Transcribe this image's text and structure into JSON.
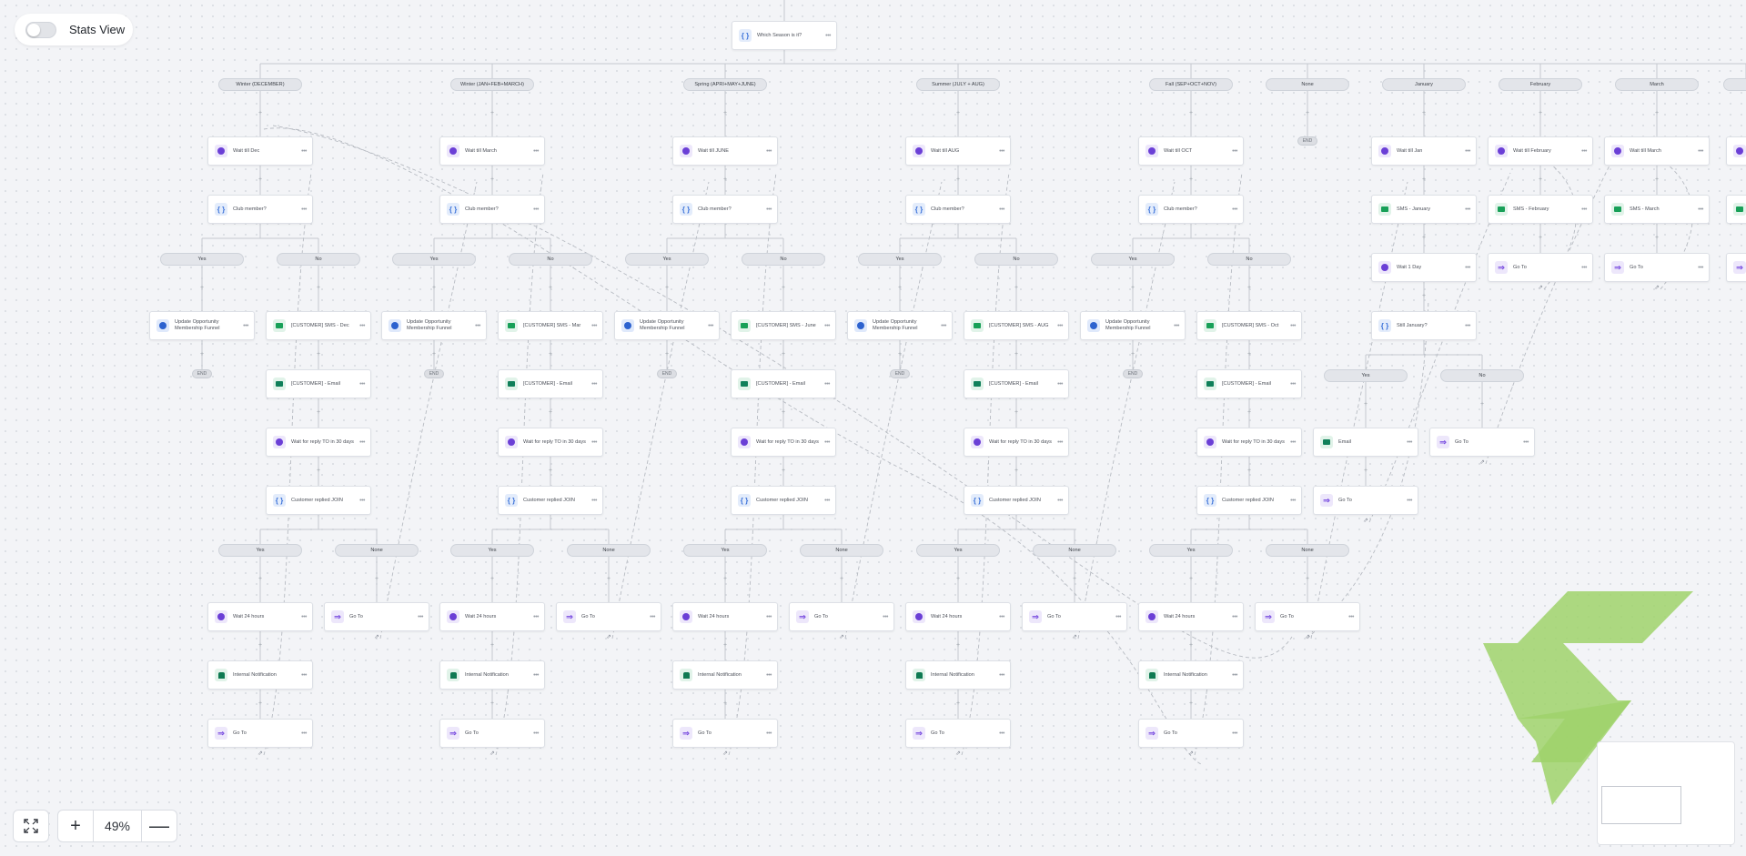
{
  "toolbar": {
    "stats_view_label": "Stats View",
    "stats_view_on": false,
    "zoom_level": "49%",
    "zoom_in_symbol": "+",
    "zoom_out_symbol": "—"
  },
  "root": {
    "label": "Which Season is it?",
    "icon": "condition-icon"
  },
  "branches": [
    {
      "label": "Winter (DECEMBER)",
      "wait": "Wait till Dec",
      "sms": "[CUSTOMER] SMS - Dec"
    },
    {
      "label": "Winter (JAN+FEB+MARCH)",
      "wait": "Wait till March",
      "sms": "[CUSTOMER] SMS - Mar"
    },
    {
      "label": "Spring (APRI+MAY+JUNE)",
      "wait": "Wait till JUNE",
      "sms": "[CUSTOMER] SMS - June"
    },
    {
      "label": "Summer (JULY + AUG)",
      "wait": "Wait till AUG",
      "sms": "[CUSTOMER] SMS - AUG"
    },
    {
      "label": "Fall (SEP+OCT+NOV)",
      "wait": "Wait till OCT",
      "sms": "[CUSTOMER] SMS - Oct"
    }
  ],
  "none_branch": {
    "label": "None",
    "end": "END"
  },
  "season_steps": {
    "club_member": "Club member?",
    "yes": "Yes",
    "no": "No",
    "none": "None",
    "update_opportunity": "Update Opportunity Membership Funnel",
    "end": "END",
    "email": "[CUSTOMER] - Email",
    "wait_reply": "Wait for reply TO in 30 days",
    "customer_replied": "Customer replied JOIN",
    "wait_24": "Wait 24 hours",
    "goto": "Go To",
    "internal_notification": "Internal Notification"
  },
  "month_branches": [
    {
      "label": "January",
      "wait": "Wait till Jan",
      "sms": "SMS - January"
    },
    {
      "label": "February",
      "wait": "Wait till February",
      "sms": "SMS - February"
    },
    {
      "label": "March",
      "wait": "Wait till March",
      "sms": "SMS - March"
    }
  ],
  "january_steps": {
    "wait_day": "Wait 1 Day",
    "still_january": "Still January?",
    "yes": "Yes",
    "no": "No",
    "email": "Email",
    "goto": "Go To"
  },
  "icons": {
    "wait": "clock-icon",
    "condition": "braces-icon",
    "sms": "chat-icon",
    "email": "envelope-icon",
    "opportunity": "dollar-icon",
    "notification": "bell-icon",
    "goto": "goto-arrow-icon",
    "jump": "jump-link-icon",
    "fit": "fit-screen-icon"
  },
  "colors": {
    "wait": "#6b3fd6",
    "condition": "#3b72d9",
    "sms": "#18a058",
    "opportunity": "#2c62cf",
    "watermark": "#9fd26b"
  }
}
